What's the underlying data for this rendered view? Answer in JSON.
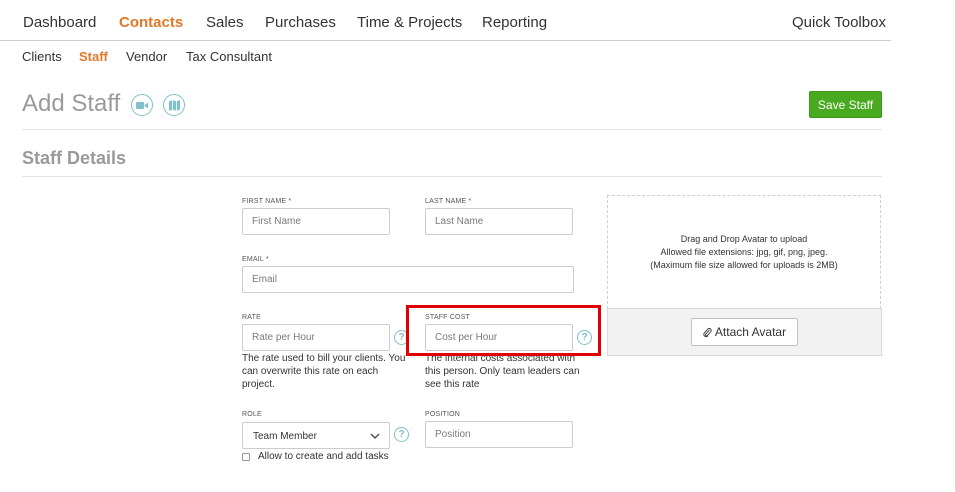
{
  "topnav": {
    "items": [
      {
        "label": "Dashboard"
      },
      {
        "label": "Contacts"
      },
      {
        "label": "Sales"
      },
      {
        "label": "Purchases"
      },
      {
        "label": "Time & Projects"
      },
      {
        "label": "Reporting"
      }
    ],
    "active": "Contacts",
    "quick_toolbox": "Quick Toolbox"
  },
  "subnav": {
    "items": [
      {
        "label": "Clients"
      },
      {
        "label": "Staff"
      },
      {
        "label": "Vendor"
      },
      {
        "label": "Tax Consultant"
      }
    ],
    "active": "Staff"
  },
  "page": {
    "title": "Add Staff",
    "save_label": "Save Staff",
    "section_title": "Staff Details",
    "title_icons": [
      "video-camera-icon",
      "map-icon"
    ]
  },
  "form": {
    "first_name": {
      "label": "FIRST NAME *",
      "placeholder": "First Name"
    },
    "last_name": {
      "label": "LAST NAME *",
      "placeholder": "Last Name"
    },
    "email": {
      "label": "EMAIL *",
      "placeholder": "Email"
    },
    "rate": {
      "label": "RATE",
      "placeholder": "Rate per Hour",
      "help": "The rate used to bill your clients. You can overwrite this rate on each project."
    },
    "staff_cost": {
      "label": "STAFF COST",
      "placeholder": "Cost per Hour",
      "help": "The internal costs associated with this person. Only team leaders can see this rate"
    },
    "role": {
      "label": "ROLE",
      "value": "Team Member"
    },
    "position": {
      "label": "POSITION",
      "placeholder": "Position"
    },
    "allow_tasks": {
      "label": "Allow to create and add tasks",
      "checked": false
    },
    "help_glyph": "?"
  },
  "avatar": {
    "line1": "Drag and Drop Avatar to upload",
    "line2": "Allowed file extensions: jpg, gif, png, jpeg.",
    "line3": "(Maximum file size allowed for uploads is 2MB)",
    "attach_label": "Attach Avatar"
  },
  "colors": {
    "accent": "#e0782a",
    "save_button": "#4aaa1f",
    "help_icon": "#7fc1cb",
    "highlight": "#e00000"
  }
}
